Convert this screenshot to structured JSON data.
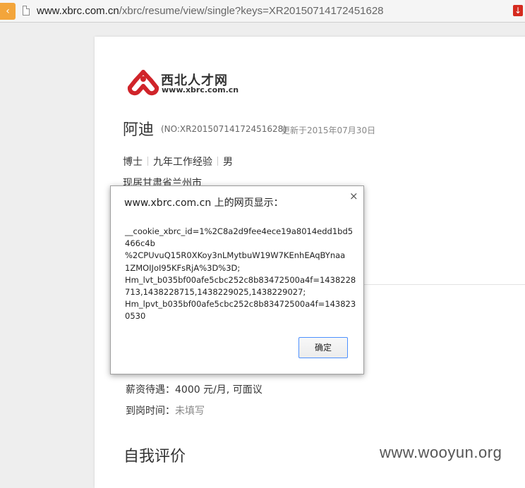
{
  "browser": {
    "url_domain": "www.xbrc.com.cn",
    "url_path": "/xbrc/resume/view/single?keys=XR20150714172451628"
  },
  "logo": {
    "cn_text": "西北人才网",
    "en_text": "www.xbrc.com.cn",
    "color": "#d0242a"
  },
  "resume": {
    "name": "阿迪",
    "number": "(NO:XR20150714172451628)",
    "updated": "更新于2015年07月30日",
    "degree": "博士",
    "experience": "九年工作经验",
    "gender": "男",
    "location": "现居甘肃省兰州市",
    "salary_label": "薪资待遇：",
    "salary_value": "4000 元/月, 可面议",
    "arrival_label": "到岗时间：",
    "arrival_value": "未填写",
    "section_title": "自我评价"
  },
  "dialog": {
    "title": "www.xbrc.com.cn 上的网页显示：",
    "close_symbol": "×",
    "message": "__cookie_xbrc_id=1%2C8a2d9fee4ece19a8014edd1bd5\n466c4b\n%2CPUvuQ15R0XKoy3nLMytbuW19W7KEnhEAqBYnaa\n1ZMOIJoI95KFsRjA%3D%3D;\nHm_lvt_b035bf00afe5cbc252c8b83472500a4f=1438228\n713,1438228715,1438229025,1438229027;\nHm_lpvt_b035bf00afe5cbc252c8b83472500a4f=143823\n0530",
    "ok_label": "确定"
  },
  "watermark": "www.wooyun.org"
}
